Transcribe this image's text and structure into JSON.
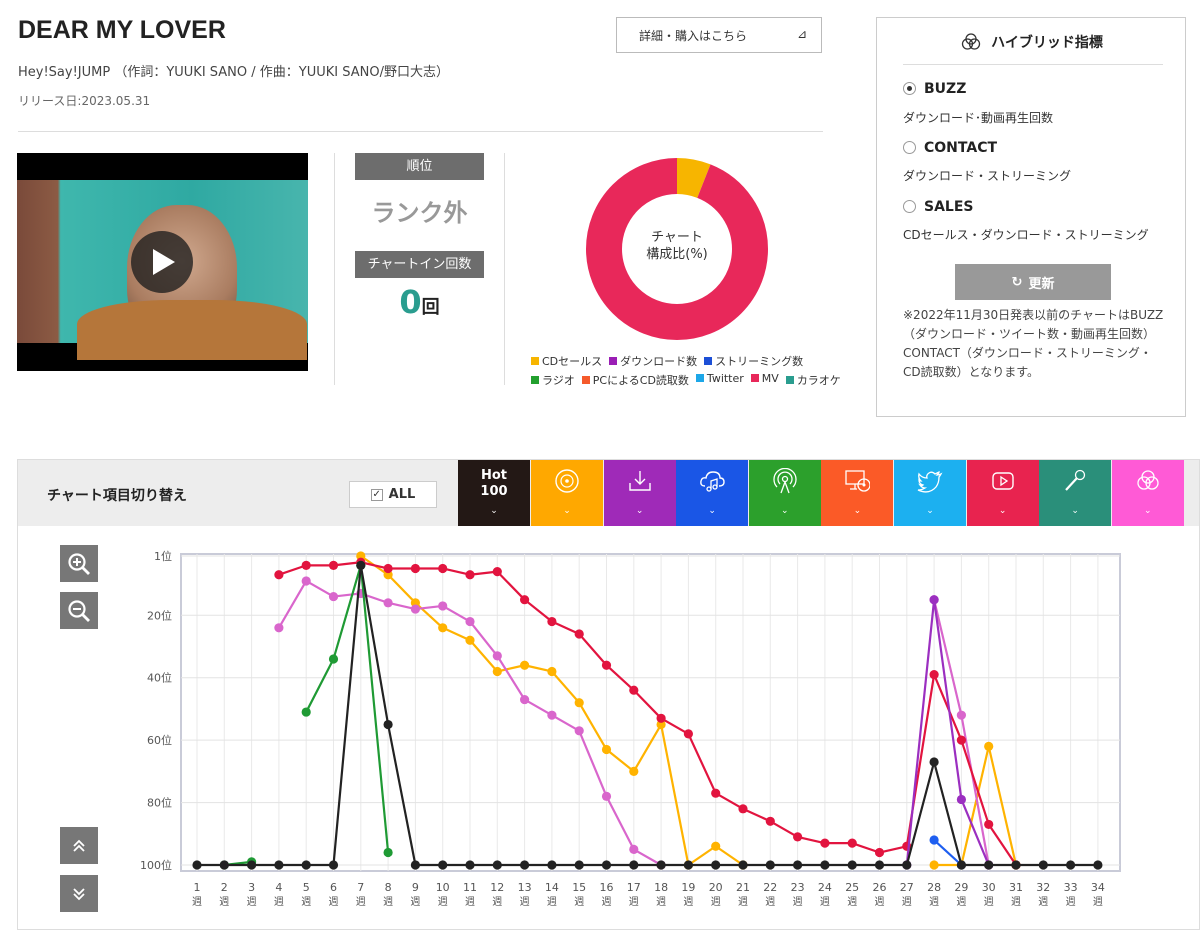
{
  "song": {
    "title": "DEAR MY LOVER",
    "credits": "Hey!Say!JUMP （作詞：YUUKI SANO / 作曲：YUUKI SANO/野口大志）",
    "release": "リリース日:2023.05.31",
    "detail_button": "詳細・購入はこちら"
  },
  "rank": {
    "header": "順位",
    "value": "ランク外",
    "chartin_header": "チャートイン回数",
    "chartin_count": "0",
    "chartin_unit": "回"
  },
  "donut": {
    "label_line1": "チャート",
    "label_line2": "構成比(%)",
    "segments": [
      {
        "name": "CDセールス",
        "value": 6,
        "color": "#f7b500"
      },
      {
        "name": "MV",
        "value": 94,
        "color": "#e8285a"
      }
    ],
    "legend_row1": [
      {
        "name": "CDセールス",
        "color": "#f7b500"
      },
      {
        "name": "ダウンロード数",
        "color": "#9a1eb5"
      },
      {
        "name": "ストリーミング数",
        "color": "#1c4fd6"
      }
    ],
    "legend_row2": [
      {
        "name": "ラジオ",
        "color": "#23a02e"
      },
      {
        "name": "PCによるCD読取数",
        "color": "#f55a2b"
      },
      {
        "name": "Twitter",
        "color": "#1da7e8"
      },
      {
        "name": "MV",
        "color": "#e8285a"
      },
      {
        "name": "カラオケ",
        "color": "#2a9d8f"
      }
    ]
  },
  "hybrid": {
    "title": "ハイブリッド指標",
    "options": [
      {
        "label": "BUZZ",
        "desc": "ダウンロード･動画再生回数",
        "selected": true
      },
      {
        "label": "CONTACT",
        "desc": "ダウンロード・ストリーミング",
        "selected": false
      },
      {
        "label": "SALES",
        "desc": "CDセールス・ダウンロード・ストリーミング",
        "selected": false
      }
    ],
    "update_button": "更新",
    "note": "※2022年11月30日発表以前のチャートはBUZZ（ダウンロード・ツイート数・動画再生回数）CONTACT（ダウンロード・ストリーミング・CD読取数）となります。"
  },
  "toggle": {
    "label": "チャート項目切り替え",
    "all_label": "ALL",
    "hot_label_1": "Hot",
    "hot_label_2": "100",
    "tabs": [
      {
        "name": "cd-sales",
        "icon": "disc-icon",
        "color": "#ffa800"
      },
      {
        "name": "download",
        "icon": "download-icon",
        "color": "#9f2ab8"
      },
      {
        "name": "streaming",
        "icon": "cloud-music-icon",
        "color": "#1a56e6"
      },
      {
        "name": "radio",
        "icon": "radio-icon",
        "color": "#2ca02c"
      },
      {
        "name": "pc-cd-read",
        "icon": "pc-disc-icon",
        "color": "#fb5a27"
      },
      {
        "name": "twitter",
        "icon": "twitter-icon",
        "color": "#1cb0f0"
      },
      {
        "name": "mv",
        "icon": "youtube-icon",
        "color": "#e8234f"
      },
      {
        "name": "karaoke",
        "icon": "microphone-icon",
        "color": "#2a8f7a"
      },
      {
        "name": "hybrid",
        "icon": "hybrid-icon",
        "color": "#ff5ad6"
      }
    ]
  },
  "chart_data": {
    "type": "line",
    "x": [
      1,
      2,
      3,
      4,
      5,
      6,
      7,
      8,
      9,
      10,
      11,
      12,
      13,
      14,
      15,
      16,
      17,
      18,
      19,
      20,
      21,
      22,
      23,
      24,
      25,
      26,
      27,
      28,
      29,
      30,
      31,
      32,
      33,
      34
    ],
    "x_tick_suffix": "週",
    "y_ticks": [
      "1位",
      "20位",
      "40位",
      "60位",
      "80位",
      "100位"
    ],
    "y_tick_values": [
      1,
      20,
      40,
      60,
      80,
      100
    ],
    "ylim": [
      1,
      100
    ],
    "y_inverted": true,
    "grid": true,
    "series": [
      {
        "key": "cd_sales",
        "color": "#ffb300",
        "values": [
          null,
          null,
          null,
          null,
          null,
          null,
          1,
          7,
          16,
          24,
          28,
          38,
          36,
          38,
          48,
          63,
          70,
          55,
          101,
          94,
          101,
          null,
          null,
          null,
          null,
          null,
          null,
          101,
          101,
          62,
          101,
          null,
          null,
          null
        ]
      },
      {
        "key": "hybrid",
        "color": "#d966cc",
        "values": [
          null,
          null,
          null,
          24,
          9,
          14,
          13,
          16,
          18,
          17,
          22,
          33,
          47,
          52,
          57,
          78,
          95,
          101,
          null,
          null,
          null,
          null,
          null,
          null,
          null,
          null,
          null,
          15,
          52,
          101,
          null,
          null,
          null,
          null
        ]
      },
      {
        "key": "mv",
        "color": "#e2143f",
        "values": [
          null,
          null,
          null,
          7,
          4,
          4,
          3,
          5,
          5,
          5,
          7,
          6,
          15,
          22,
          26,
          36,
          44,
          53,
          58,
          77,
          82,
          86,
          91,
          93,
          93,
          96,
          94,
          39,
          60,
          87,
          101,
          null,
          null,
          null
        ]
      },
      {
        "key": "download",
        "color": "#9b2fc0",
        "values": [
          null,
          null,
          null,
          null,
          null,
          null,
          null,
          null,
          null,
          null,
          null,
          null,
          null,
          null,
          null,
          null,
          null,
          null,
          null,
          null,
          null,
          null,
          null,
          null,
          null,
          null,
          101,
          15,
          79,
          101,
          null,
          null,
          null,
          null
        ]
      },
      {
        "key": "radio",
        "color": "#1f9a34",
        "values": [
          null,
          101,
          99,
          null,
          51,
          34,
          4,
          96,
          null,
          null,
          null,
          null,
          null,
          null,
          null,
          null,
          null,
          null,
          null,
          null,
          null,
          null,
          null,
          null,
          null,
          null,
          null,
          null,
          null,
          null,
          null,
          null,
          null,
          null
        ]
      },
      {
        "key": "streaming",
        "color": "#1e5ef0",
        "values": [
          null,
          null,
          null,
          null,
          null,
          null,
          null,
          null,
          null,
          null,
          null,
          null,
          null,
          null,
          null,
          null,
          null,
          null,
          null,
          null,
          null,
          null,
          null,
          null,
          null,
          null,
          null,
          92,
          101,
          null,
          null,
          null,
          null,
          null
        ]
      },
      {
        "key": "hot100",
        "color": "#222222",
        "values": [
          101,
          101,
          101,
          101,
          101,
          101,
          4,
          55,
          101,
          101,
          101,
          101,
          101,
          101,
          101,
          101,
          101,
          101,
          101,
          101,
          101,
          101,
          101,
          101,
          101,
          101,
          101,
          67,
          101,
          101,
          101,
          101,
          101,
          101
        ]
      }
    ]
  }
}
